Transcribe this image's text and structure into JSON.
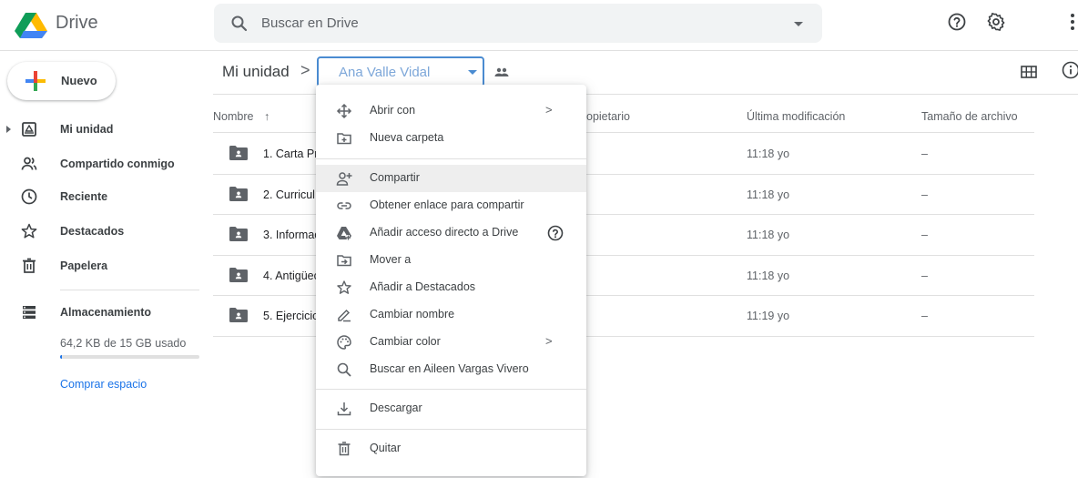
{
  "header": {
    "app_name": "Drive",
    "search_placeholder": "Buscar en Drive"
  },
  "sidebar": {
    "new_label": "Nuevo",
    "items": [
      {
        "label": "Mi unidad",
        "icon": "my-drive-icon"
      },
      {
        "label": "Compartido conmigo",
        "icon": "shared-with-me-icon"
      },
      {
        "label": "Reciente",
        "icon": "clock-icon"
      },
      {
        "label": "Destacados",
        "icon": "star-icon"
      },
      {
        "label": "Papelera",
        "icon": "trash-icon"
      }
    ],
    "storage": {
      "label": "Almacenamiento",
      "usage": "64,2 KB de 15 GB usado",
      "used_fraction": 0.01,
      "buy_label": "Comprar espacio"
    }
  },
  "breadcrumb": {
    "root": "Mi unidad",
    "separator": ">",
    "current": "Ana Valle Vidal"
  },
  "table": {
    "headers": {
      "name": "Nombre",
      "owner": "opietario",
      "modified": "Última modificación",
      "size": "Tamaño de archivo"
    },
    "rows": [
      {
        "name": "1. Carta Pr",
        "modified": "11:18 yo",
        "size": "–"
      },
      {
        "name": "2. Curricul",
        "modified": "11:18 yo",
        "size": "–"
      },
      {
        "name": "3. Informac",
        "modified": "11:18 yo",
        "size": "–"
      },
      {
        "name": "4. Antigüec",
        "modified": "11:18 yo",
        "size": "–"
      },
      {
        "name": "5. Ejercicio",
        "modified": "11:19 yo",
        "size": "–"
      }
    ]
  },
  "context_menu": {
    "items": [
      {
        "label": "Abrir con",
        "icon": "open-with-icon",
        "submenu": ">"
      },
      {
        "label": "Nueva carpeta",
        "icon": "new-folder-icon"
      },
      {
        "label": "Compartir",
        "icon": "share-icon"
      },
      {
        "label": "Obtener enlace para compartir",
        "icon": "link-icon"
      },
      {
        "label": "Añadir acceso directo a Drive",
        "icon": "add-shortcut-icon"
      },
      {
        "label": "Mover a",
        "icon": "move-to-icon"
      },
      {
        "label": "Añadir a Destacados",
        "icon": "star-icon"
      },
      {
        "label": "Cambiar nombre",
        "icon": "rename-icon"
      },
      {
        "label": "Cambiar color",
        "icon": "palette-icon",
        "submenu": ">"
      },
      {
        "label": "Buscar en Aileen Vargas Vivero",
        "icon": "search-icon"
      },
      {
        "label": "Descargar",
        "icon": "download-icon"
      },
      {
        "label": "Quitar",
        "icon": "trash-icon"
      }
    ]
  },
  "colors": {
    "accent": "#1a73e8",
    "highlight_border": "#4a8bd1"
  }
}
